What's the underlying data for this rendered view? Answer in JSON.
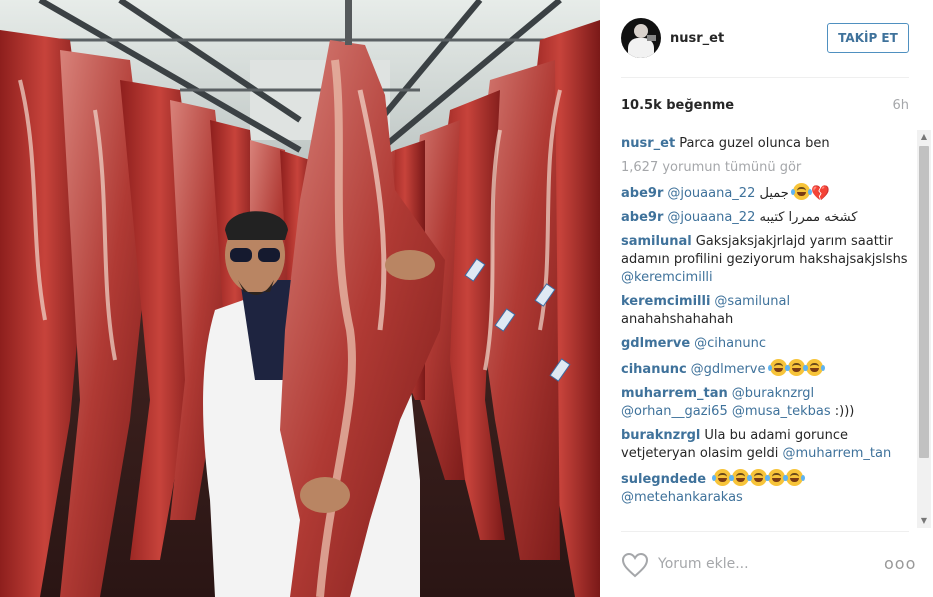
{
  "post": {
    "username": "nusr_et",
    "follow_label": "TAKİP ET",
    "likes": "10.5k beğenme",
    "time": "6h",
    "caption": {
      "user": "nusr_et",
      "text": "Parca guzel olunca ben"
    },
    "view_all": "1,627 yorumun tümünü gör"
  },
  "comments": [
    {
      "user": "abe9r",
      "mention": "@jouaana_22",
      "text": "جميل",
      "emojis": [
        "laugh-cry-emoji",
        "broken-heart-emoji"
      ]
    },
    {
      "user": "abe9r",
      "mention": "@jouaana_22",
      "text": "كشخه ممررا كتيبه"
    },
    {
      "user": "samilunal",
      "text": "Gaksjaksjakjrlajd yarım saattir adamın profilini geziyorum hakshajsakjslshs",
      "mention": "@keremcimilli"
    },
    {
      "user": "keremcimilli",
      "mention": "@samilunal",
      "text": "anahahshahahah"
    },
    {
      "user": "gdlmerve",
      "mention": "@cihanunc",
      "text": ""
    },
    {
      "user": "cihanunc",
      "mention": "@gdlmerve",
      "text": "",
      "emojis": [
        "laugh-cry-emoji",
        "laugh-cry-emoji",
        "laugh-cry-emoji"
      ]
    },
    {
      "user": "muharrem_tan",
      "mention": "@buraknzrgl @orhan__gazi65 @musa_tekbas",
      "text": ":)))"
    },
    {
      "user": "buraknzrgl",
      "text": "Ula bu adami gorunce vetjeteryan olasim geldi",
      "mention": "@muharrem_tan"
    },
    {
      "user": "sulegndede",
      "text": "",
      "emojis": [
        "laugh-cry-emoji",
        "laugh-cry-emoji",
        "laugh-cry-emoji",
        "laugh-cry-emoji",
        "laugh-cry-emoji"
      ],
      "mention": "@metehankarakas"
    }
  ],
  "footer": {
    "placeholder": "Yorum ekle...",
    "more_label": "ooo"
  },
  "colors": {
    "link": "#3f729b",
    "muted": "#a5a7aa",
    "button_border": "#4f90c0"
  },
  "icons": {
    "like": "heart-outline-icon",
    "options": "more-options-icon",
    "scroll_up": "scroll-up-arrow-icon",
    "scroll_down": "scroll-down-arrow-icon"
  }
}
